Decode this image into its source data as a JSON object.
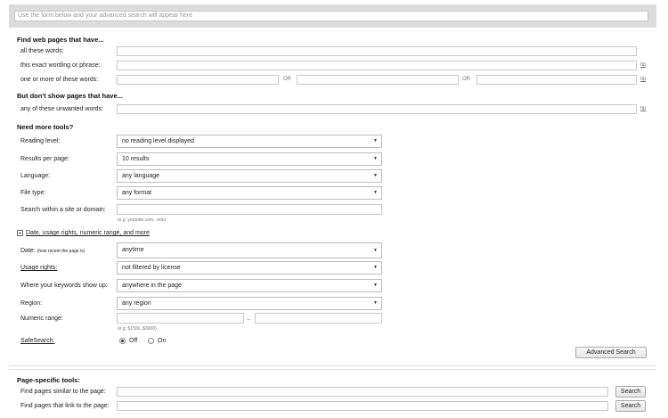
{
  "header": {
    "query_placeholder": "Use the form below and your advanced search will appear here"
  },
  "find_section": {
    "title": "Find web pages that have...",
    "all_words_label": "all these words:",
    "exact_phrase_label": "this exact wording or phrase:",
    "one_or_more_label": "one or more of these words:",
    "or_label": "OR",
    "tip_label": "tip"
  },
  "exclude_section": {
    "title": "But don't show pages that have...",
    "unwanted_label": "any of these unwanted words:"
  },
  "tools_section": {
    "title": "Need more tools?",
    "reading_level_label": "Reading level:",
    "reading_level_value": "no reading level displayed",
    "results_label": "Results per page:",
    "results_value": "10 results",
    "language_label": "Language:",
    "language_value": "any language",
    "file_type_label": "File type:",
    "file_type_value": "any format",
    "site_label": "Search within a site or domain:",
    "site_example": "(e.g. youtube.com, .edu)"
  },
  "date_section": {
    "toggle_label": "Date, usage rights, numeric range, and more",
    "date_label": "Date:",
    "date_sublabel": "(how recent the page is)",
    "date_value": "anytime",
    "usage_label": "Usage rights:",
    "usage_value": "not filtered by license",
    "where_label": "Where your keywords show up:",
    "where_value": "anywhere in the page",
    "region_label": "Region:",
    "region_value": "any region",
    "numeric_label": "Numeric range:",
    "numeric_sep": "..",
    "numeric_example": "(e.g. $1500..$3000)",
    "safesearch_label": "SafeSearch:",
    "safesearch_off": "Off",
    "safesearch_on": "On",
    "safesearch_selected": "Off"
  },
  "advanced_search_button": "Advanced Search",
  "page_tools": {
    "title": "Page-specific tools:",
    "similar_label": "Find pages similar to the page:",
    "link_label": "Find pages that link to the page:",
    "search_button": "Search"
  }
}
